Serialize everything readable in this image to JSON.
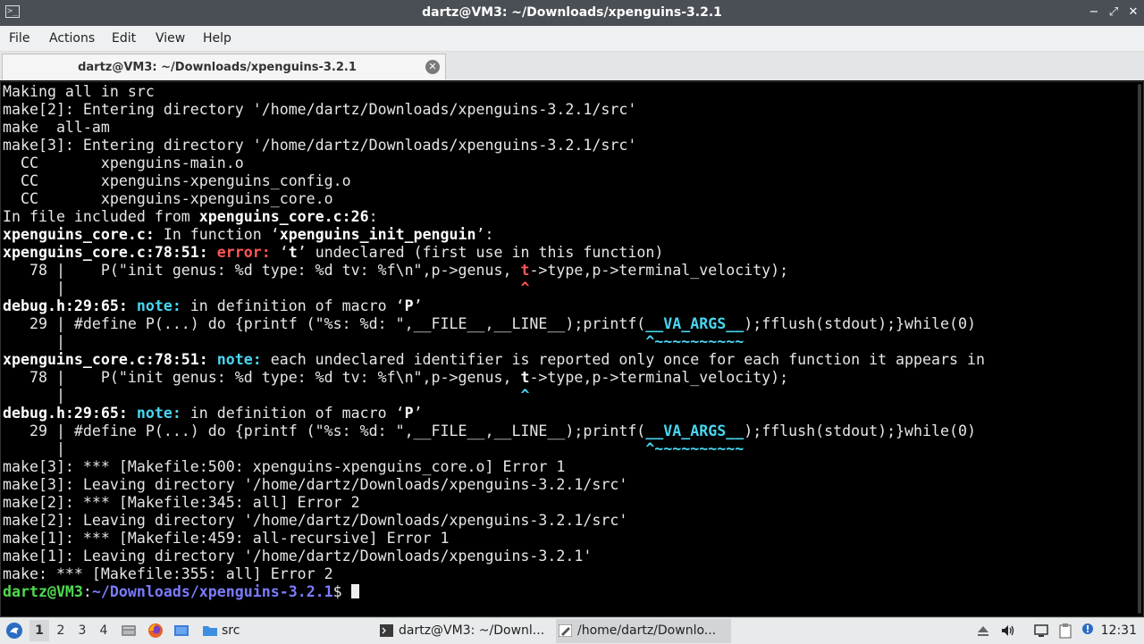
{
  "window": {
    "title": "dartz@VM3: ~/Downloads/xpenguins-3.2.1",
    "minimize": "−",
    "maximize": "⤢",
    "close": "✕"
  },
  "menu": [
    "File",
    "Actions",
    "Edit",
    "View",
    "Help"
  ],
  "tab": {
    "label": "dartz@VM3: ~/Downloads/xpenguins-3.2.1",
    "close": "✕"
  },
  "terminal": {
    "lines": [
      [
        {
          "t": "Making all in src"
        }
      ],
      [
        {
          "t": "make[2]: Entering directory '/home/dartz/Downloads/xpenguins-3.2.1/src'"
        }
      ],
      [
        {
          "t": "make  all-am"
        }
      ],
      [
        {
          "t": "make[3]: Entering directory '/home/dartz/Downloads/xpenguins-3.2.1/src'"
        }
      ],
      [
        {
          "t": "  CC       xpenguins-main.o"
        }
      ],
      [
        {
          "t": "  CC       xpenguins-xpenguins_config.o"
        }
      ],
      [
        {
          "t": "  CC       xpenguins-xpenguins_core.o"
        }
      ],
      [
        {
          "t": "In file included from "
        },
        {
          "t": "xpenguins_core.c:26",
          "s": "b"
        },
        {
          "t": ":"
        }
      ],
      [
        {
          "t": "xpenguins_core.c:",
          "s": "b"
        },
        {
          "t": " In function ‘"
        },
        {
          "t": "xpenguins_init_penguin",
          "s": "b"
        },
        {
          "t": "’:"
        }
      ],
      [
        {
          "t": "xpenguins_core.c:78:51:",
          "s": "b"
        },
        {
          "t": " "
        },
        {
          "t": "error:",
          "s": "red"
        },
        {
          "t": " ‘"
        },
        {
          "t": "t",
          "s": "b"
        },
        {
          "t": "’ undeclared (first use in this function)"
        }
      ],
      [
        {
          "t": "   78 |    P(\"init genus: %d type: %d tv: %f\\n\",p->genus, "
        },
        {
          "t": "t",
          "s": "red"
        },
        {
          "t": "->type,p->terminal_velocity);"
        }
      ],
      [
        {
          "t": "      |                                                   "
        },
        {
          "t": "^",
          "s": "red"
        }
      ],
      [
        {
          "t": "debug.h:29:65:",
          "s": "b"
        },
        {
          "t": " "
        },
        {
          "t": "note:",
          "s": "cyan"
        },
        {
          "t": " in definition of macro ‘"
        },
        {
          "t": "P",
          "s": "b"
        },
        {
          "t": "’"
        }
      ],
      [
        {
          "t": "   29 | #define P(...) do {printf (\"%s: %d: \",__FILE__,__LINE__);printf("
        },
        {
          "t": "__VA_ARGS__",
          "s": "cyan"
        },
        {
          "t": ");fflush(stdout);}while(0)"
        }
      ],
      [
        {
          "t": "      |                                                                 "
        },
        {
          "t": "^~~~~~~~~~~",
          "s": "cyan"
        }
      ],
      [
        {
          "t": "xpenguins_core.c:78:51:",
          "s": "b"
        },
        {
          "t": " "
        },
        {
          "t": "note:",
          "s": "cyan"
        },
        {
          "t": " each undeclared identifier is reported only once for each function it appears in"
        }
      ],
      [
        {
          "t": "   78 |    P(\"init genus: %d type: %d tv: %f\\n\",p->genus, "
        },
        {
          "t": "t",
          "s": "b"
        },
        {
          "t": "->type,p->terminal_velocity);"
        }
      ],
      [
        {
          "t": "      |                                                   "
        },
        {
          "t": "^",
          "s": "cyan"
        }
      ],
      [
        {
          "t": "debug.h:29:65:",
          "s": "b"
        },
        {
          "t": " "
        },
        {
          "t": "note:",
          "s": "cyan"
        },
        {
          "t": " in definition of macro ‘"
        },
        {
          "t": "P",
          "s": "b"
        },
        {
          "t": "’"
        }
      ],
      [
        {
          "t": "   29 | #define P(...) do {printf (\"%s: %d: \",__FILE__,__LINE__);printf("
        },
        {
          "t": "__VA_ARGS__",
          "s": "cyan"
        },
        {
          "t": ");fflush(stdout);}while(0)"
        }
      ],
      [
        {
          "t": "      |                                                                 "
        },
        {
          "t": "^~~~~~~~~~~",
          "s": "cyan"
        }
      ],
      [
        {
          "t": "make[3]: *** [Makefile:500: xpenguins-xpenguins_core.o] Error 1"
        }
      ],
      [
        {
          "t": "make[3]: Leaving directory '/home/dartz/Downloads/xpenguins-3.2.1/src'"
        }
      ],
      [
        {
          "t": "make[2]: *** [Makefile:345: all] Error 2"
        }
      ],
      [
        {
          "t": "make[2]: Leaving directory '/home/dartz/Downloads/xpenguins-3.2.1/src'"
        }
      ],
      [
        {
          "t": "make[1]: *** [Makefile:459: all-recursive] Error 1"
        }
      ],
      [
        {
          "t": "make[1]: Leaving directory '/home/dartz/Downloads/xpenguins-3.2.1'"
        }
      ],
      [
        {
          "t": "make: *** [Makefile:355: all] Error 2"
        }
      ]
    ],
    "prompt": {
      "userhost": "dartz@VM3",
      "sep": ":",
      "path": "~/Downloads/xpenguins-3.2.1",
      "symbol": "$ "
    }
  },
  "taskbar": {
    "workspaces": [
      "1",
      "2",
      "3",
      "4"
    ],
    "active_workspace": "1",
    "folder_label": "src",
    "tasks": [
      {
        "label": "dartz@VM3: ~/Downl...",
        "icon": "terminal-icon"
      },
      {
        "label": "/home/dartz/Downlo...",
        "icon": "text-editor-icon"
      }
    ],
    "clock": "12:31"
  },
  "colors": {
    "terminal_bg": "#000000",
    "error": "#ff5555",
    "note": "#48d6f0",
    "prompt_user": "#4fdc4f",
    "prompt_path": "#7b7bff"
  }
}
